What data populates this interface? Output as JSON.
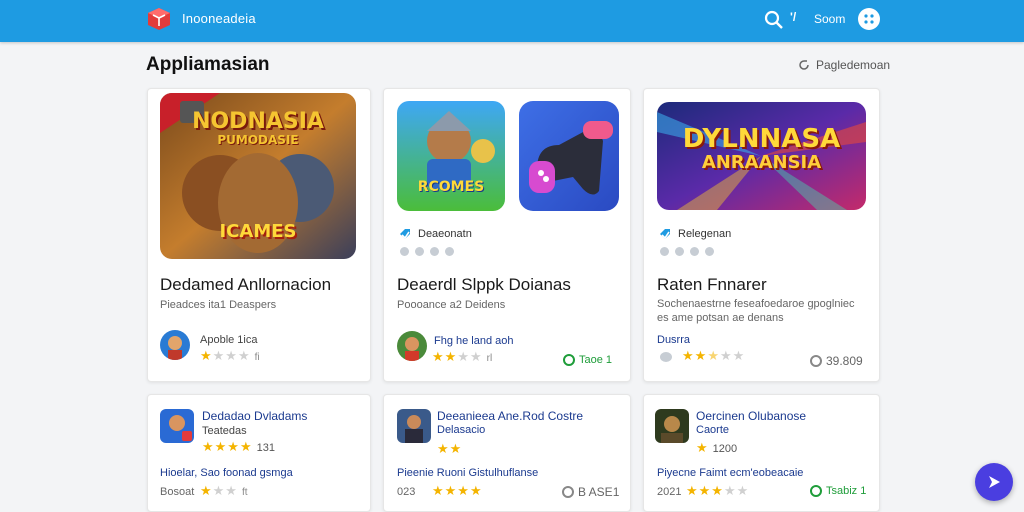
{
  "header": {
    "brand": "Inooneadeia",
    "search_label": "Soom"
  },
  "section": {
    "title": "Appliamasian",
    "link_label": "Pagledemoan"
  },
  "featured": [
    {
      "art_title": "NODNASIA",
      "art_sub": "PUMODASIE",
      "art_caption": "ICAMES",
      "title": "Dedamed Anllornacion",
      "subtitle": "Pieadces ita1 Deaspers",
      "author": "Apoble 1ica",
      "rating": 1,
      "rating_count": "fi"
    },
    {
      "art_title": "RCOMES",
      "label": "Deaeonatn",
      "title": "Deaerdl Slppk Doianas",
      "subtitle": "Poooance a2 Deidens",
      "author": "Fhg he land aoh",
      "rating": 2,
      "rating_count": "rl",
      "badge": "Taoe 1"
    },
    {
      "art_title": "DYLNNASA",
      "art_sub": "ANRAANSIA",
      "label": "Relegenan",
      "title": "Raten Fnnarer",
      "subtitle": "Sochenaestrne feseafoedaroe gpoglniec es ame potsan ae denans",
      "author": "Dusrra",
      "rating": 2.5,
      "badge": "39.809"
    }
  ],
  "listing": [
    {
      "title": "Dedadao Dvladams",
      "subtitle": "Teatedas",
      "rating": 4,
      "count": "131",
      "footer": "Hioelar, Sao foonad gsmga",
      "footer_num": "Bosoat",
      "footer_rating": 1,
      "footer_count": "ft"
    },
    {
      "title": "Deeanieea Ane.Rod Costre",
      "subtitle": "Delasacio",
      "rating": 2,
      "count": "",
      "footer": "Pieenie Ruoni Gistulhuflanse",
      "footer_num": "023",
      "footer_rating": 4,
      "footer_count": "",
      "badge": "B ASE1"
    },
    {
      "title": "Oercinen Olubanose",
      "subtitle": "Caorte",
      "rating": 1,
      "count": "1200",
      "footer": "Piyecne Faimt ecm'eobeacaie",
      "footer_num": "2021",
      "footer_rating": 3,
      "footer_count": "",
      "badge": "Tsabiz 1"
    }
  ],
  "colors": {
    "accent": "#1e9be2",
    "fab": "#4a3ee0",
    "star": "#f4b400",
    "success": "#1f9d3a"
  },
  "icons": {
    "logo": "cube-logo-icon",
    "search": "search-icon",
    "account": "account-icon",
    "fab": "play-arrow-icon"
  }
}
